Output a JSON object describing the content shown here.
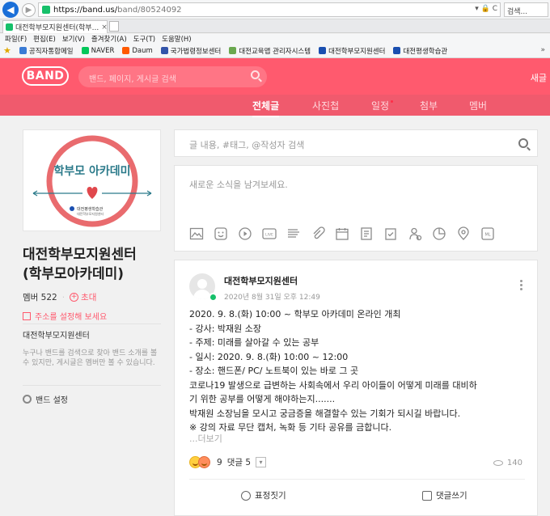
{
  "browser": {
    "url_base": "https://band.us/",
    "url_path": "band/80524092",
    "search_placeholder": "검색...",
    "tab_title": "대전학부모지원센터(학부...",
    "tab_close": "×",
    "addr_icons": "▾ 🔒 C",
    "menu": [
      "파일(F)",
      "편집(E)",
      "보기(V)",
      "즐겨찾기(A)",
      "도구(T)",
      "도움말(H)"
    ],
    "favorites": [
      {
        "label": "공직자통합메일",
        "color": "#3a7bd5"
      },
      {
        "label": "NAVER",
        "color": "#03c75a"
      },
      {
        "label": "Daum",
        "color": "#ff5a00"
      },
      {
        "label": "국가법령정보센터",
        "color": "#3355aa"
      },
      {
        "label": "대전교육맵 관리자시스템",
        "color": "#6aa84f"
      },
      {
        "label": "대전학부모지원센터",
        "color": "#1a4fb0"
      },
      {
        "label": "대전평생학습관",
        "color": "#1a4fb0"
      }
    ],
    "fav_more": "»"
  },
  "band": {
    "logo": "BAND",
    "search_placeholder": "밴드, 페이지, 게시글 검색",
    "new_label": "새글",
    "tabs": [
      "전체글",
      "사진첩",
      "일정",
      "첨부",
      "멤버"
    ]
  },
  "sidebar": {
    "cover_title": "학부모 아카데미",
    "cover_org": "대전평생학습관",
    "cover_org_sub": "대전학부모지원센터",
    "group_name_line1": "대전학부모지원센터",
    "group_name_line2": "(학부모아카데미)",
    "members_label": "멤버 522",
    "invite_label": "초대",
    "address_label": "주소를 설정해 보세요",
    "org_label": "대전학부모지원센터",
    "description": "누구나 밴드를 검색으로 찾아 밴드 소개를 볼 수 있지만, 게시글은 멤버만 볼 수 있습니다.",
    "settings_label": "밴드 설정"
  },
  "feed": {
    "search_placeholder": "글 내용, #태그, @작성자 검색",
    "composer_placeholder": "새로운 소식을 남겨보세요.",
    "tool_icons": [
      "image-icon",
      "sticker-icon",
      "video-icon",
      "live-icon",
      "schedule-list-icon",
      "attach-icon",
      "calendar-icon",
      "todo-icon",
      "checklist-icon",
      "people-icon",
      "poll-icon",
      "location-icon",
      "ml-icon"
    ],
    "tool_ml": "ML",
    "tool_live": "LIVE",
    "post": {
      "author": "대전학부모지원센터",
      "date": "2020년 8월 31일 오후 12:49",
      "lines": [
        "2020. 9. 8.(화) 10:00 ~  학부모 아카데미 온라인 개최",
        "- 강사: 박재원 소장",
        "- 주제: 미래를 살아갈 수 있는 공부",
        "- 일시: 2020. 9. 8.(화) 10:00 ~ 12:00",
        "- 장소: 핸드폰/ PC/ 노트북이 있는 바로 그 곳",
        "코로나19 발생으로 급변하는 사회속에서 우리 아이들이 어떻게 미래를 대비하",
        "기 위한 공부를 어떻게 해야하는지.......",
        " 박재원 소장님을 모시고 궁금증을 해결할수 있는 기회가 되시길 바랍니다.",
        "※ 강의 자료 무단 캡처, 녹화 등 기타 공유를 금합니다."
      ],
      "read_more": "...더보기",
      "reaction_count": "9",
      "comment_count": "댓글 5",
      "view_count": "140",
      "emote_label": "표정짓기",
      "comment_label": "댓글쓰기"
    }
  },
  "colors": {
    "brand": "#ff5a6e",
    "brand_tabs": "#f05a6d"
  }
}
